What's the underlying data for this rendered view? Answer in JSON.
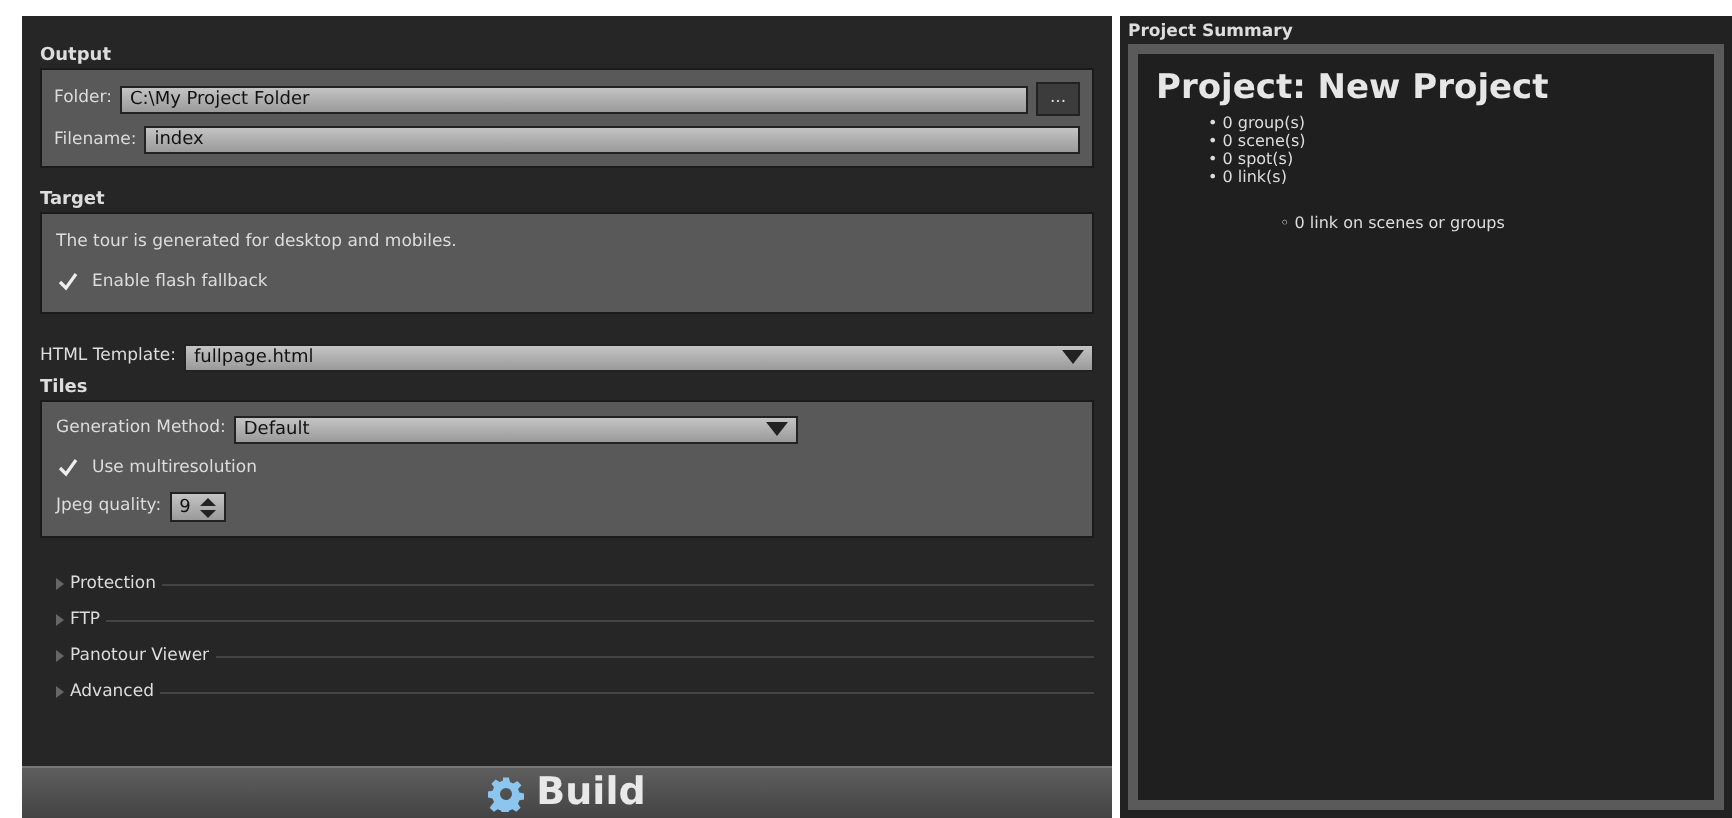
{
  "output": {
    "title": "Output",
    "folder_label": "Folder:",
    "folder_value": "C:\\My Project Folder",
    "browse_button": "...",
    "filename_label": "Filename:",
    "filename_value": "index"
  },
  "target": {
    "title": "Target",
    "description": "The tour is generated for desktop and mobiles.",
    "flash_fallback": {
      "label": "Enable flash fallback",
      "checked": true
    }
  },
  "html_template": {
    "label": "HTML Template:",
    "value": "fullpage.html"
  },
  "tiles": {
    "title": "Tiles",
    "method_label": "Generation Method:",
    "method_value": "Default",
    "multiresolution": {
      "label": "Use multiresolution",
      "checked": true
    },
    "jpeg_label": "Jpeg quality:",
    "jpeg_value": "9"
  },
  "sections": [
    {
      "label": "Protection",
      "expanded": false
    },
    {
      "label": "FTP",
      "expanded": false
    },
    {
      "label": "Panotour Viewer",
      "expanded": false
    },
    {
      "label": "Advanced",
      "expanded": false
    }
  ],
  "build_button": "Build",
  "summary": {
    "title": "Project Summary",
    "heading": "Project: New Project",
    "items": [
      {
        "text": "• 0 group(s)"
      },
      {
        "text": "• 0 scene(s)"
      },
      {
        "text": "• 0 spot(s)"
      },
      {
        "text": "• 0 link(s)",
        "children": [
          {
            "text": "◦ 0 link on scenes or groups"
          }
        ]
      }
    ]
  }
}
